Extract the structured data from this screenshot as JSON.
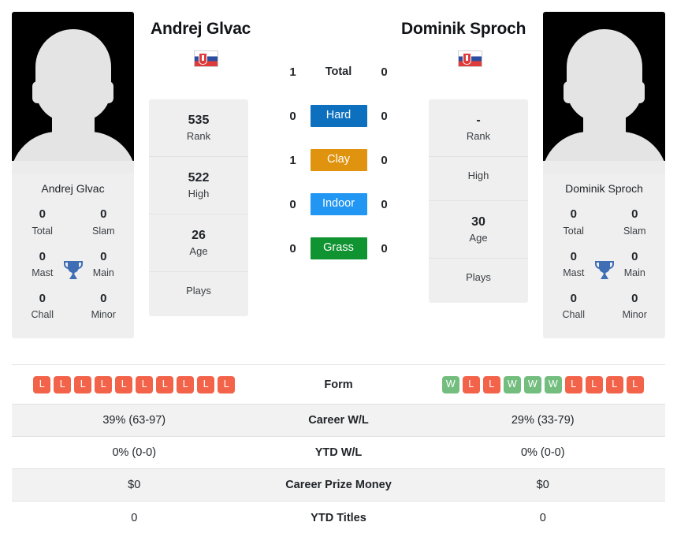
{
  "players": {
    "left": {
      "name": "Andrej Glvac",
      "country": "Slovakia",
      "flag_icon": "slovakia-flag-icon",
      "photo_alt": "player-photo-placeholder",
      "titles": {
        "total": "0",
        "total_label": "Total",
        "slam": "0",
        "slam_label": "Slam",
        "mast": "0",
        "mast_label": "Mast",
        "main": "0",
        "main_label": "Main",
        "chall": "0",
        "chall_label": "Chall",
        "minor": "0",
        "minor_label": "Minor",
        "trophy_icon": "trophy-icon"
      },
      "profile": [
        {
          "value": "535",
          "label": "Rank"
        },
        {
          "value": "522",
          "label": "High"
        },
        {
          "value": "26",
          "label": "Age"
        },
        {
          "value": "",
          "label": "Plays"
        }
      ],
      "h2h": {
        "total": "1",
        "hard": "0",
        "clay": "1",
        "indoor": "0",
        "grass": "0"
      },
      "form": [
        "L",
        "L",
        "L",
        "L",
        "L",
        "L",
        "L",
        "L",
        "L",
        "L"
      ],
      "career_wl": "39% (63-97)",
      "ytd_wl": "0% (0-0)",
      "career_prize_money": "$0",
      "ytd_titles": "0"
    },
    "right": {
      "name": "Dominik Sproch",
      "country": "Slovakia",
      "flag_icon": "slovakia-flag-icon",
      "photo_alt": "player-photo-placeholder",
      "titles": {
        "total": "0",
        "total_label": "Total",
        "slam": "0",
        "slam_label": "Slam",
        "mast": "0",
        "mast_label": "Mast",
        "main": "0",
        "main_label": "Main",
        "chall": "0",
        "chall_label": "Chall",
        "minor": "0",
        "minor_label": "Minor",
        "trophy_icon": "trophy-icon"
      },
      "profile": [
        {
          "value": "-",
          "label": "Rank"
        },
        {
          "value": "",
          "label": "High"
        },
        {
          "value": "30",
          "label": "Age"
        },
        {
          "value": "",
          "label": "Plays"
        }
      ],
      "h2h": {
        "total": "0",
        "hard": "0",
        "clay": "0",
        "indoor": "0",
        "grass": "0"
      },
      "form": [
        "W",
        "L",
        "L",
        "W",
        "W",
        "W",
        "L",
        "L",
        "L",
        "L"
      ],
      "career_wl": "29% (33-79)",
      "ytd_wl": "0% (0-0)",
      "career_prize_money": "$0",
      "ytd_titles": "0"
    }
  },
  "h2h_rows": [
    {
      "key": "total",
      "label": "Total",
      "badge": false,
      "color": ""
    },
    {
      "key": "hard",
      "label": "Hard",
      "badge": true,
      "color": "#0c70bf"
    },
    {
      "key": "clay",
      "label": "Clay",
      "badge": true,
      "color": "#e0930f"
    },
    {
      "key": "indoor",
      "label": "Indoor",
      "badge": true,
      "color": "#2196f3"
    },
    {
      "key": "grass",
      "label": "Grass",
      "badge": true,
      "color": "#109432"
    }
  ],
  "comparison_rows": [
    {
      "label": "Form",
      "shaded": false
    },
    {
      "label": "Career W/L",
      "shaded": true
    },
    {
      "label": "YTD W/L",
      "shaded": false
    },
    {
      "label": "Career Prize Money",
      "shaded": true
    },
    {
      "label": "YTD Titles",
      "shaded": false
    }
  ],
  "colors": {
    "win_badge": "#73bd7f",
    "loss_badge": "#f2634a",
    "card_bg": "#efefef",
    "row_shaded": "#f2f2f2",
    "trophy": "#3f6eb5"
  }
}
